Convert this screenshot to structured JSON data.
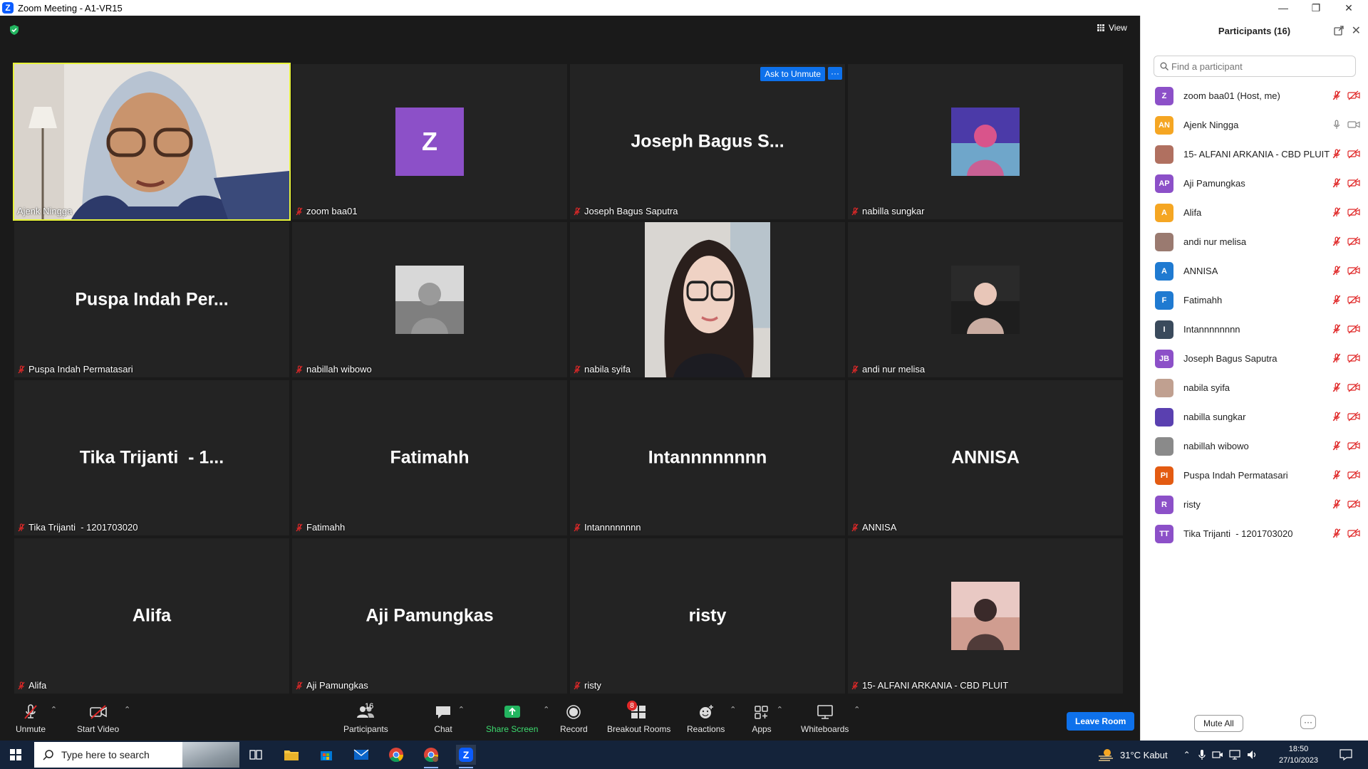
{
  "window": {
    "title": "Zoom Meeting - A1-VR15",
    "logo_letter": "Z"
  },
  "stage": {
    "view_label": "View"
  },
  "tiles": [
    {
      "name": "Ajenk Ningga",
      "kind": "video",
      "active": true
    },
    {
      "name": "zoom baa01",
      "kind": "avatar",
      "avatar_letter": "Z",
      "avatar_color": "#8c50c8"
    },
    {
      "name": "Joseph Bagus Saputra",
      "kind": "text",
      "display": "Joseph Bagus S...",
      "ask_to_unmute": "Ask to Unmute",
      "more": "···"
    },
    {
      "name": "nabilla sungkar",
      "kind": "photo",
      "photo_palette": [
        "#4b3aa8",
        "#d9548b",
        "#7fd4d8"
      ]
    },
    {
      "name": "Puspa Indah Permatasari",
      "kind": "text",
      "display": "Puspa Indah Per..."
    },
    {
      "name": "nabillah wibowo",
      "kind": "photo",
      "photo_palette": [
        "#d8d8d8",
        "#9a9a9a",
        "#5a5a5a"
      ]
    },
    {
      "name": "nabila syifa",
      "kind": "selfie"
    },
    {
      "name": "andi nur melisa",
      "kind": "photo",
      "photo_palette": [
        "#2a2a2a",
        "#e8c6b8",
        "#1a1a1a"
      ]
    },
    {
      "name": "Tika Trijanti  - 1201703020",
      "kind": "text",
      "display": "Tika Trijanti  - 1..."
    },
    {
      "name": "Fatimahh",
      "kind": "text",
      "display": "Fatimahh"
    },
    {
      "name": "Intannnnnnnn",
      "kind": "text",
      "display": "Intannnnnnnn"
    },
    {
      "name": "ANNISA",
      "kind": "text",
      "display": "ANNISA"
    },
    {
      "name": "Alifa",
      "kind": "text",
      "display": "Alifa"
    },
    {
      "name": "Aji Pamungkas",
      "kind": "text",
      "display": "Aji Pamungkas"
    },
    {
      "name": "risty",
      "kind": "text",
      "display": "risty"
    },
    {
      "name": "15- ALFANI ARKANIA - CBD PLUIT",
      "kind": "photo",
      "photo_palette": [
        "#e9c9c4",
        "#3a2a2a",
        "#c48a7a"
      ]
    }
  ],
  "toolbar": {
    "unmute": "Unmute",
    "start_video": "Start Video",
    "participants": "Participants",
    "participants_count": "16",
    "chat": "Chat",
    "share_screen": "Share Screen",
    "record": "Record",
    "breakout_rooms": "Breakout Rooms",
    "breakout_badge": "8",
    "reactions": "Reactions",
    "apps": "Apps",
    "whiteboards": "Whiteboards",
    "leave_room": "Leave Room"
  },
  "panel": {
    "title": "Participants (16)",
    "search_placeholder": "Find a participant",
    "mute_all": "Mute All",
    "more": "···",
    "participants": [
      {
        "name": "zoom baa01 (Host, me)",
        "initials": "Z",
        "color": "#8c50c8",
        "mic_on": false
      },
      {
        "name": "Ajenk Ningga",
        "initials": "AN",
        "color": "#f5a623",
        "mic_on": true
      },
      {
        "name": "15- ALFANI ARKANIA - CBD PLUIT",
        "initials": "",
        "color": "#b07060",
        "mic_on": false
      },
      {
        "name": "Aji Pamungkas",
        "initials": "AP",
        "color": "#8c50c8",
        "mic_on": false
      },
      {
        "name": "Alifa",
        "initials": "A",
        "color": "#f5a623",
        "mic_on": false
      },
      {
        "name": "andi nur melisa",
        "initials": "",
        "color": "#9a7a70",
        "mic_on": false
      },
      {
        "name": "ANNISA",
        "initials": "A",
        "color": "#1f7ad1",
        "mic_on": false
      },
      {
        "name": "Fatimahh",
        "initials": "F",
        "color": "#1f7ad1",
        "mic_on": false
      },
      {
        "name": "Intannnnnnnn",
        "initials": "I",
        "color": "#3a4a5c",
        "mic_on": false
      },
      {
        "name": "Joseph Bagus Saputra",
        "initials": "JB",
        "color": "#8c50c8",
        "mic_on": false
      },
      {
        "name": "nabila syifa",
        "initials": "",
        "color": "#c0a090",
        "mic_on": false
      },
      {
        "name": "nabilla sungkar",
        "initials": "",
        "color": "#5a40b0",
        "mic_on": false
      },
      {
        "name": "nabillah wibowo",
        "initials": "",
        "color": "#8a8a8a",
        "mic_on": false
      },
      {
        "name": "Puspa Indah Permatasari",
        "initials": "PI",
        "color": "#e35b12",
        "mic_on": false
      },
      {
        "name": "risty",
        "initials": "R",
        "color": "#8c50c8",
        "mic_on": false
      },
      {
        "name": "Tika Trijanti  - 1201703020",
        "initials": "TT",
        "color": "#8c50c8",
        "mic_on": false
      }
    ]
  },
  "taskbar": {
    "search_placeholder": "Type here to search",
    "weather": "31°C  Kabut",
    "time": "18:50",
    "date": "27/10/2023"
  }
}
